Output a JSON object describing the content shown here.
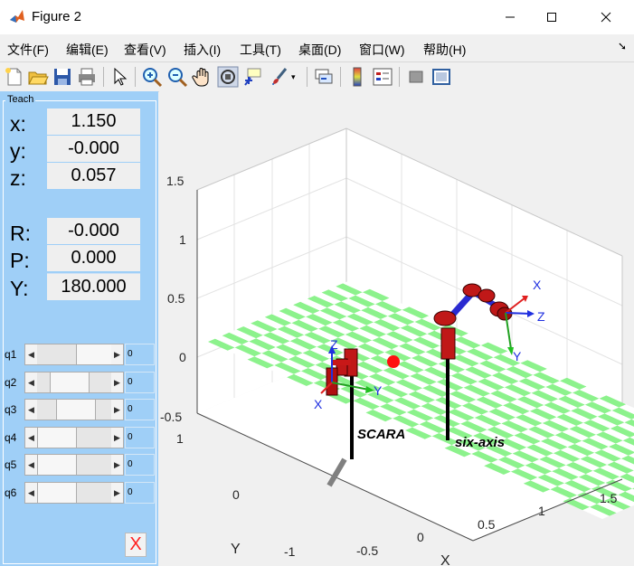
{
  "window": {
    "title": "Figure 2"
  },
  "menu": [
    "文件(F)",
    "编辑(E)",
    "查看(V)",
    "插入(I)",
    "工具(T)",
    "桌面(D)",
    "窗口(W)",
    "帮助(H)"
  ],
  "toolbar_icons": [
    "new-figure-icon",
    "open-file-icon",
    "save-icon",
    "print-icon",
    "select-arrow-icon",
    "zoom-in-icon",
    "zoom-out-icon",
    "pan-hand-icon",
    "rotate-3d-icon",
    "data-cursor-icon",
    "brush-icon",
    "link-plot-icon",
    "colorbar-icon",
    "legend-icon",
    "hide-plot-tools-icon",
    "show-plot-tools-icon"
  ],
  "teach": {
    "title": "Teach",
    "pos_labels": {
      "x": "x:",
      "y": "y:",
      "z": "z:"
    },
    "pos_values": {
      "x": "1.150",
      "y": "-0.000",
      "z": "0.057"
    },
    "rot_labels": {
      "r": "R:",
      "p": "P:",
      "yw": "Y:"
    },
    "rot_values": {
      "r": "-0.000",
      "p": "0.000",
      "yw": "180.000"
    },
    "joints": [
      {
        "label": "q1",
        "value": "0"
      },
      {
        "label": "q2",
        "value": "0"
      },
      {
        "label": "q3",
        "value": "0"
      },
      {
        "label": "q4",
        "value": "0"
      },
      {
        "label": "q5",
        "value": "0"
      },
      {
        "label": "q6",
        "value": "0"
      }
    ],
    "close_label": "X"
  },
  "plot": {
    "z_ticks": [
      "1.5",
      "1",
      "0.5",
      "0",
      "-0.5"
    ],
    "y_ticks": [
      "1",
      "0",
      "-1"
    ],
    "x_ticks": [
      "-0.5",
      "0",
      "0.5",
      "1",
      "1.5"
    ],
    "xlabel": "X",
    "ylabel": "Y",
    "robot_labels": {
      "scara": "SCARA",
      "sixaxis": "six-axis"
    },
    "frame_axis_labels": {
      "x": "X",
      "y": "Y",
      "z": "Z"
    }
  }
}
